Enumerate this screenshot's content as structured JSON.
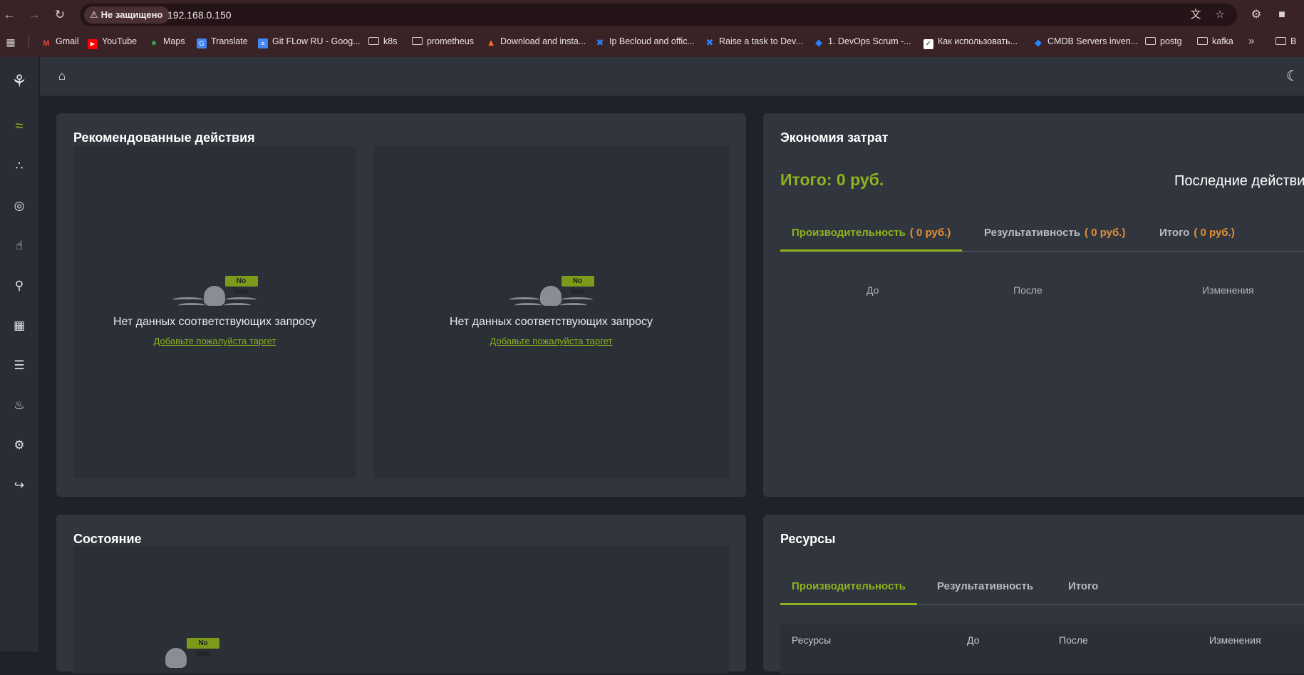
{
  "browser": {
    "security_label": "Не защищено",
    "url": "192.168.0.150",
    "bookmarks": [
      {
        "label": "Gmail",
        "icon": "gmail-icon",
        "color": "#ea4335"
      },
      {
        "label": "YouTube",
        "icon": "youtube-icon",
        "color": "#ff0000"
      },
      {
        "label": "Maps",
        "icon": "maps-icon",
        "color": "#34a853"
      },
      {
        "label": "Translate",
        "icon": "translate-icon",
        "color": "#4285f4"
      },
      {
        "label": "Git FLow RU - Goog...",
        "icon": "google-docs-icon",
        "color": "#4285f4"
      },
      {
        "label": "k8s",
        "icon": "folder-icon"
      },
      {
        "label": "prometheus",
        "icon": "folder-icon"
      },
      {
        "label": "Download and insta...",
        "icon": "gitlab-icon",
        "color": "#fc6d26"
      },
      {
        "label": "Ip Becloud and offic...",
        "icon": "confluence-icon",
        "color": "#2684ff"
      },
      {
        "label": "Raise a task to Dev...",
        "icon": "jira-icon",
        "color": "#2684ff"
      },
      {
        "label": "1. DevOps Scrum -...",
        "icon": "jira-diamond-icon",
        "color": "#2684ff"
      },
      {
        "label": "Как использовать...",
        "icon": "page-icon",
        "color": "#ffffff"
      },
      {
        "label": "CMDB Servers inven...",
        "icon": "jira-diamond-icon",
        "color": "#2684ff"
      },
      {
        "label": "postg",
        "icon": "folder-icon"
      },
      {
        "label": "kafka",
        "icon": "folder-icon"
      },
      {
        "label": "B",
        "icon": "folder-icon"
      }
    ]
  },
  "colors": {
    "accent": "#8fb31d",
    "amount": "#e0913a",
    "card_bg": "#31353d"
  },
  "recommended": {
    "title": "Рекомендованные действия",
    "badge": "No data",
    "empty_text": "Нет данных соответствующих запросу",
    "add_target_link": "Добавьте пожалуйста таргет"
  },
  "savings": {
    "title": "Экономия затрат",
    "total": "Итого: 0 руб.",
    "last_actions": "Последние действи",
    "tabs": [
      {
        "label": "Производительность",
        "amount": "( 0 руб.)"
      },
      {
        "label": "Результативность",
        "amount": "( 0 руб.)"
      },
      {
        "label": "Итого",
        "amount": "( 0 руб.)"
      }
    ],
    "columns": [
      "До",
      "После",
      "Изменения"
    ]
  },
  "state": {
    "title": "Состояние",
    "badge": "No data"
  },
  "resources": {
    "title": "Ресурсы",
    "tabs": [
      "Производительность",
      "Результативность",
      "Итого"
    ],
    "columns": [
      "Ресурсы",
      "До",
      "После",
      "Изменения"
    ]
  }
}
